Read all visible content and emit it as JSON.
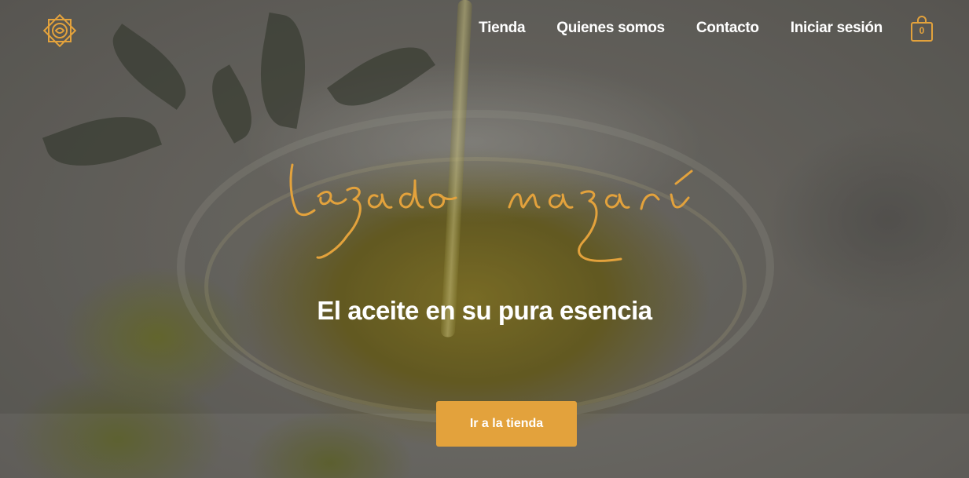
{
  "brand": {
    "logo_icon": "ornamental-star-logo-icon",
    "script_name": "Legado nazarí",
    "accent_color": "#e3a23c"
  },
  "nav": {
    "items": [
      {
        "label": "Tienda"
      },
      {
        "label": "Quienes somos"
      },
      {
        "label": "Contacto"
      },
      {
        "label": "Iniciar sesión"
      }
    ],
    "cart": {
      "icon": "shopping-bag-icon",
      "count": "0"
    }
  },
  "hero": {
    "tagline": "El aceite en su pura esencia",
    "cta_label": "Ir a la tienda"
  }
}
